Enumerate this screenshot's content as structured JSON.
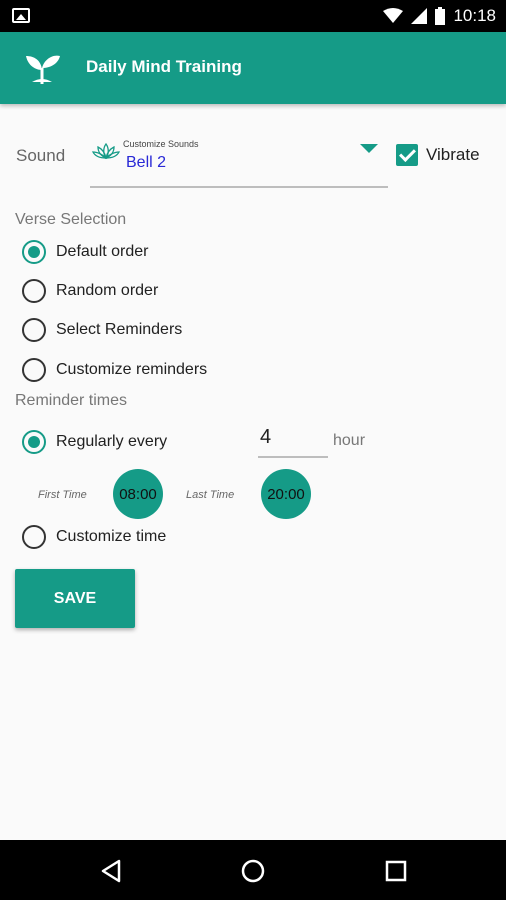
{
  "status_bar": {
    "time": "10:18",
    "icons": [
      "image-icon",
      "wifi-icon",
      "cell-signal-icon",
      "battery-icon"
    ]
  },
  "app_bar": {
    "title": "Daily Mind Training",
    "logo_icon": "sprout-icon"
  },
  "sound": {
    "label": "Sound",
    "dropdown_title": "Customize Sounds",
    "selected_value": "Bell 2",
    "vibrate_label": "Vibrate",
    "vibrate_checked": true
  },
  "verse_selection": {
    "title": "Verse Selection",
    "options": [
      {
        "label": "Default order",
        "selected": true
      },
      {
        "label": "Random order",
        "selected": false
      },
      {
        "label": "Select Reminders",
        "selected": false
      },
      {
        "label": "Customize reminders",
        "selected": false
      }
    ]
  },
  "reminder_times": {
    "title": "Reminder times",
    "regular_label": "Regularly every",
    "regular_selected": true,
    "interval_value": "4",
    "interval_unit": "hour",
    "first_time_label": "First Time",
    "first_time": "08:00",
    "last_time_label": "Last Time",
    "last_time": "20:00",
    "custom_label": "Customize time",
    "custom_selected": false
  },
  "actions": {
    "save_label": "SAVE"
  },
  "colors": {
    "accent": "#159b87",
    "link_blue": "#2929d6"
  },
  "nav_bar": {
    "icons": [
      "back-icon",
      "home-icon",
      "recents-icon"
    ]
  }
}
